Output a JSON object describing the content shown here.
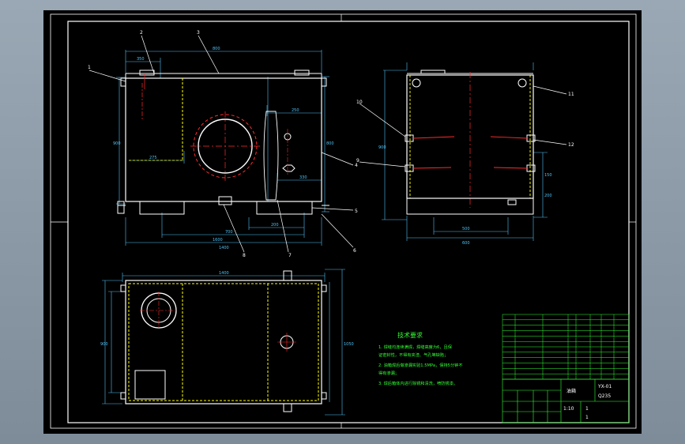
{
  "colors": {
    "background": "#000000",
    "frame": "#ffffff",
    "geometry": "#ffffff",
    "hidden_lines": "#ffff00",
    "center_lines": "#ff2a2a",
    "dimensions": "#4fc3f7",
    "leaders": "#ffffff",
    "notes": "#33ff33",
    "title_block": "#33ff33",
    "viewport": "#8c9aa8"
  },
  "balloons": [
    "1",
    "2",
    "3",
    "4",
    "5",
    "6",
    "7",
    "8",
    "9",
    "10",
    "11",
    "12"
  ],
  "dimensions": {
    "front": [
      "800",
      "1600",
      "350",
      "900",
      "275",
      "250",
      "330",
      "800",
      "1400",
      "700",
      "200"
    ],
    "side": [
      "900",
      "600",
      "500",
      "150",
      "200"
    ],
    "top": [
      "1400",
      "900",
      "1050"
    ]
  },
  "notes": {
    "title": "技术要求",
    "items": [
      "1. 焊缝均连续满焊，焊缝高度为6，且保",
      "   证密封性，不得有夹渣、气孔等缺陷；",
      "2. 油箱焊后做渗漏实验1.5MPa，保持5分钟不",
      "   得有渗漏；",
      "3. 焊后箱体内进行除锈和清洗，喷防锈漆。"
    ]
  },
  "title_block": {
    "part_name": "油箱",
    "material": "Q235",
    "scale": "1:10",
    "drawing_number": "YX-01",
    "sheet": "1",
    "sheets": "1",
    "bom_rows": 12
  }
}
